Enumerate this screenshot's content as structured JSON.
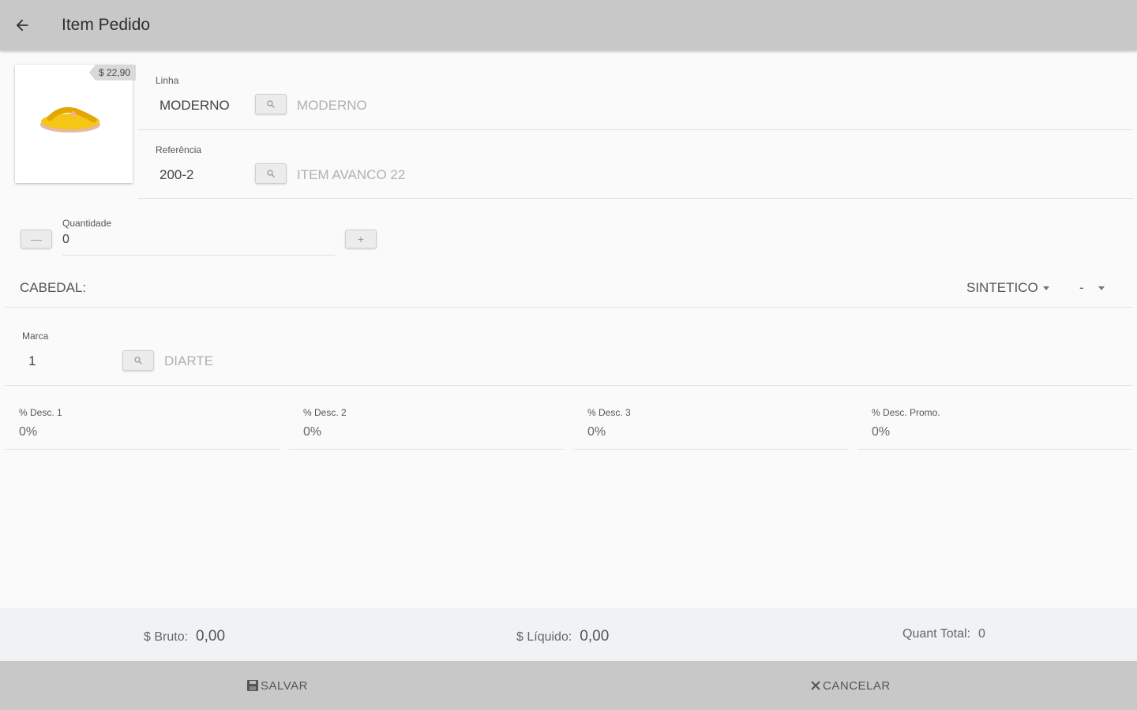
{
  "header": {
    "title": "Item Pedido",
    "back_icon": "arrow-left-icon"
  },
  "product": {
    "price": "$ 22,90",
    "image_desc_icon": "sandal-image"
  },
  "linha": {
    "label": "Linha",
    "value": "MODERNO",
    "description": "MODERNO"
  },
  "referencia": {
    "label": "Referência",
    "value": "200-2",
    "description": "ITEM AVANCO 22"
  },
  "quantidade": {
    "label": "Quantidade",
    "value": "0",
    "minus": "—",
    "plus": "+"
  },
  "cabedal": {
    "label": "CABEDAL:",
    "material": "SINTETICO",
    "option": "-"
  },
  "marca": {
    "label": "Marca",
    "value": "1",
    "description": "DIARTE"
  },
  "discounts": [
    {
      "label": "% Desc. 1",
      "value": "0%"
    },
    {
      "label": "% Desc. 2",
      "value": "0%"
    },
    {
      "label": "% Desc. 3",
      "value": "0%"
    },
    {
      "label": "% Desc. Promo.",
      "value": "0%"
    }
  ],
  "totals": {
    "bruto_label": "$ Bruto:",
    "bruto_value": "0,00",
    "liquido_label": "$ Líquido:",
    "liquido_value": "0,00",
    "quant_label": "Quant Total:",
    "quant_value": "0"
  },
  "actions": {
    "save_label": "SALVAR",
    "cancel_label": "CANCELAR"
  },
  "colors": {
    "appbar": "#c8c8c8",
    "background": "#fafafa",
    "accent_product": "#f5c518"
  }
}
